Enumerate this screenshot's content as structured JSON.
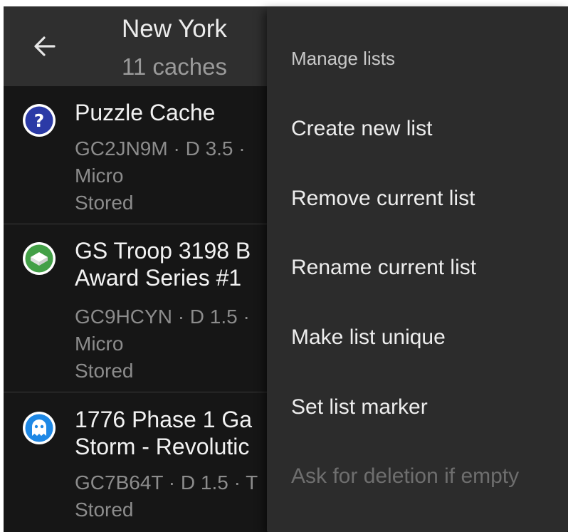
{
  "toolbar": {
    "title": "New York",
    "subtitle": "11 caches"
  },
  "caches": [
    {
      "icon": "puzzle-question-icon",
      "icon_color": "#2b3aa6",
      "title_lines": [
        "Puzzle Cache"
      ],
      "code_line": "GC2JN9M · D 3.5 ·",
      "size": "Micro",
      "status": "Stored"
    },
    {
      "icon": "traditional-box-icon",
      "icon_color": "#43a047",
      "title_lines": [
        "GS Troop 3198 B",
        "Award Series #1"
      ],
      "code_line": "GC9HCYN · D 1.5 ·",
      "size": "Micro",
      "status": "Stored"
    },
    {
      "icon": "ghost-icon",
      "icon_color": "#1e88e5",
      "title_lines": [
        "1776 Phase 1 Ga",
        "Storm - Revolutic"
      ],
      "code_line": "GC7B64T · D 1.5 · T",
      "status": "Stored"
    }
  ],
  "menu": {
    "header": "Manage lists",
    "items": [
      {
        "label": "Create new list",
        "enabled": true
      },
      {
        "label": "Remove current list",
        "enabled": true
      },
      {
        "label": "Rename current list",
        "enabled": true
      },
      {
        "label": "Make list unique",
        "enabled": true
      },
      {
        "label": "Set list marker",
        "enabled": true
      },
      {
        "label": "Ask for deletion if empty",
        "enabled": false
      }
    ]
  },
  "colors": {
    "toolbar_bg": "#2f2f2f",
    "list_bg": "#161616",
    "menu_bg": "#2c2c2c",
    "disabled_text": "#6e6e6e"
  }
}
